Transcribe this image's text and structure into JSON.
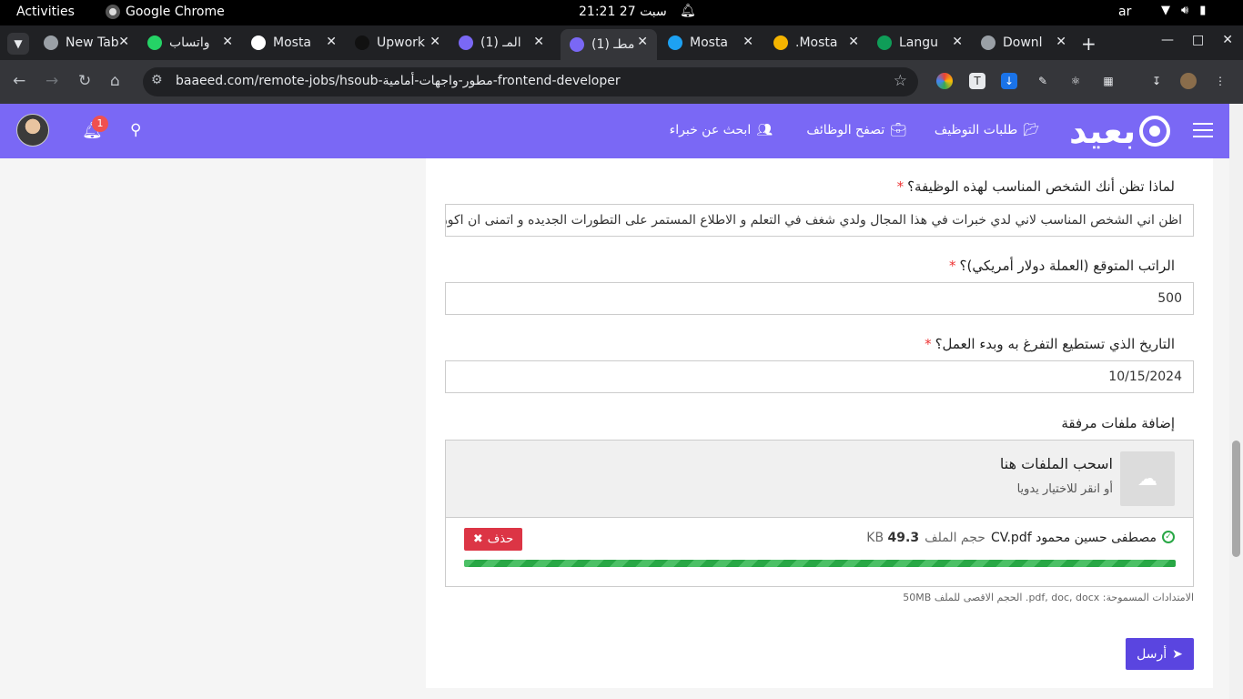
{
  "os": {
    "activities": "Activities",
    "app_name": "Google Chrome",
    "clock": "21:21  27 سبت",
    "language": "ar"
  },
  "tabs": [
    {
      "label": "New Tab",
      "icon": "chrome-icon",
      "color": "#9aa0a6"
    },
    {
      "label": "واتساب",
      "icon": "whatsapp-icon",
      "color": "#25d366"
    },
    {
      "label": "Mosta",
      "icon": "github-icon",
      "color": "#ffffff"
    },
    {
      "label": "Upwork",
      "icon": "upwork-icon",
      "color": "#111111"
    },
    {
      "label": "(1) المـ",
      "icon": "baaeed-icon",
      "color": "#7a68f5"
    },
    {
      "label": "(1) مطـ",
      "icon": "baaeed-icon",
      "color": "#7a68f5",
      "active": true
    },
    {
      "label": "Mosta",
      "icon": "circle-icon",
      "color": "#1da1f2"
    },
    {
      "label": ".Mosta",
      "icon": "number-5-icon",
      "color": "#f4b400"
    },
    {
      "label": "Langu",
      "icon": "sheet-icon",
      "color": "#0f9d58"
    },
    {
      "label": "Downl",
      "icon": "globe-icon",
      "color": "#9aa0a6"
    }
  ],
  "address": {
    "url": "baaeed.com/remote-jobs/hsoub-مطور-واجهات-أمامية-frontend-developer"
  },
  "header": {
    "logo": "بعيد",
    "nav": {
      "applications": "طلبات التوظيف",
      "browse_jobs": "تصفح الوظائف",
      "find_experts": "ابحث عن خبراء"
    },
    "notification_count": "1"
  },
  "form": {
    "q1_label": "لماذا تظن أنك الشخص المناسب لهذه الوظيفة؟",
    "q1_value": "اظن اني الشخص المناسب لاني لدي خبرات في هذا المجال  ولدي شغف في التعلم و الاطلاع المستمر على التطورات الجديده و اتمنى ان اكون اضـ",
    "q2_label": "الراتب المتوقع (العملة دولار أمريكي)؟",
    "q2_value": "500",
    "q3_label": "التاريخ الذي تستطيع التفرغ به وبدء العمل؟",
    "q3_value": "10/15/2024",
    "required_mark": "*",
    "attachments_label": "إضافة ملفات مرفقة",
    "dropzone_title": "اسحب الملفات هنا",
    "dropzone_sub": "أو انقر للاختيار يدويا",
    "file": {
      "name": "مصطفى حسين محمود CV.pdf",
      "size_label": "حجم الملف",
      "size_value": "49.3",
      "size_unit": "KB",
      "progress": 1.0
    },
    "delete_label": "حذف",
    "hint": "الامتدادات المسموحة: pdf, doc, docx. الحجم الاقصى للملف 50MB",
    "submit_label": "أرسل"
  },
  "colors": {
    "brand": "#7a68f5",
    "submit": "#5a45e0",
    "danger": "#dc3545",
    "success": "#28a745"
  }
}
